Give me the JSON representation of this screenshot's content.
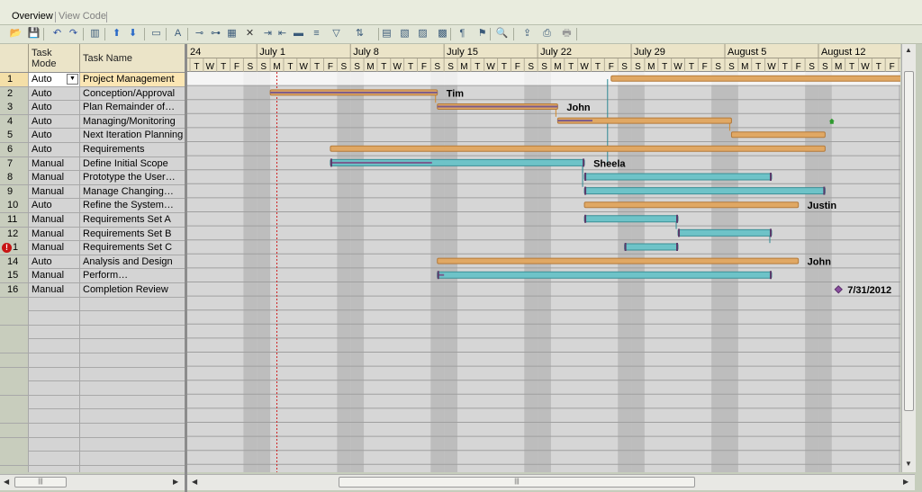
{
  "tabs": [
    {
      "label": "Overview",
      "active": true
    },
    {
      "label": "View Code",
      "active": false
    }
  ],
  "toolbar": {
    "icons": [
      "open-folder-icon",
      "save-icon",
      "undo-icon",
      "redo-icon",
      "columns-icon",
      "move-up-icon",
      "move-down-icon",
      "task-info-icon",
      "fit-text-icon",
      "link-icon",
      "unlink-icon",
      "calendar-icon",
      "delete-icon",
      "indent-icon",
      "outdent-icon",
      "progress-icon",
      "bar-style-icon",
      "filter-icon",
      "sort-icon",
      "table-icon",
      "layout-icon",
      "chart-icon",
      "report-icon",
      "format-icon",
      "critical-path-icon",
      "zoom-icon",
      "export-icon",
      "print-preview-icon",
      "print-icon"
    ]
  },
  "grid": {
    "headers": {
      "id": "",
      "mode": "Task\nMode",
      "name": "Task Name"
    },
    "rows": [
      {
        "id": "1",
        "mode": "Auto",
        "name": "Project Management",
        "selected": true,
        "warning": false
      },
      {
        "id": "2",
        "mode": "Auto",
        "name": "Conception/Approval"
      },
      {
        "id": "3",
        "mode": "Auto",
        "name": "Plan  Remainder of…"
      },
      {
        "id": "4",
        "mode": "Auto",
        "name": "Managing/Monitoring"
      },
      {
        "id": "5",
        "mode": "Auto",
        "name": "Next Iteration Planning"
      },
      {
        "id": "6",
        "mode": "Auto",
        "name": "Requirements"
      },
      {
        "id": "7",
        "mode": "Manual",
        "name": "Define Initial Scope"
      },
      {
        "id": "8",
        "mode": "Manual",
        "name": "Prototype the User…"
      },
      {
        "id": "9",
        "mode": "Manual",
        "name": "Manage  Changing…"
      },
      {
        "id": "10",
        "mode": "Auto",
        "name": "Refine the System…"
      },
      {
        "id": "11",
        "mode": "Manual",
        "name": "Requirements Set A"
      },
      {
        "id": "12",
        "mode": "Manual",
        "name": "Requirements Set B"
      },
      {
        "id": "1",
        "mode": "Manual",
        "name": "Requirements Set C",
        "warning": true
      },
      {
        "id": "14",
        "mode": "Auto",
        "name": "Analysis and Design"
      },
      {
        "id": "15",
        "mode": "Manual",
        "name": "Perform…"
      },
      {
        "id": "16",
        "mode": "Manual",
        "name": "Completion Review"
      }
    ],
    "empty_rows": 13
  },
  "timescale": {
    "weeks": [
      "24",
      "July 1",
      "July 8",
      "July 15",
      "July 22",
      "July 29",
      "August 5",
      "August 12"
    ],
    "day_letters": [
      "T",
      "W",
      "T",
      "F",
      "S",
      "S",
      "M",
      "T",
      "W",
      "T",
      "F",
      "S",
      "S",
      "M",
      "T",
      "W",
      "T",
      "F",
      "S",
      "S",
      "M",
      "T",
      "W",
      "T",
      "F",
      "S",
      "S",
      "M",
      "T",
      "W",
      "T",
      "F",
      "S",
      "S",
      "M",
      "T",
      "W",
      "T",
      "F",
      "S",
      "S",
      "M",
      "T",
      "W",
      "T",
      "F",
      "S",
      "S",
      "M",
      "T",
      "W",
      "T",
      "F",
      "S",
      "S",
      "M",
      "T",
      "W",
      "T",
      "F",
      "S",
      "S",
      "M",
      "T",
      "W",
      "T",
      "F",
      "S",
      "S",
      "M",
      "T",
      "W",
      "T",
      "F"
    ],
    "first_day_weekday": "T",
    "weekend_shade": "#bdbdbd",
    "today_line_day": 6.5
  },
  "tasks": [
    {
      "row": 0,
      "type": "summary",
      "start": 31.5,
      "end": 76,
      "label": ""
    },
    {
      "row": 1,
      "type": "summary",
      "start": 6,
      "end": 18.5,
      "label": "Tim",
      "progress": 1
    },
    {
      "row": 2,
      "type": "summary",
      "start": 18.5,
      "end": 27.5,
      "label": "John",
      "progress": 1
    },
    {
      "row": 3,
      "type": "summary",
      "start": 27.5,
      "end": 40.5,
      "label": "",
      "progress": 0.2
    },
    {
      "row": 4,
      "type": "summary",
      "start": 40.5,
      "end": 47.5,
      "label": ""
    },
    {
      "row": 5,
      "type": "summary",
      "start": 10.5,
      "end": 47.5,
      "label": ""
    },
    {
      "row": 6,
      "type": "manual",
      "start": 10.5,
      "end": 29.5,
      "label": "Sheela",
      "progress": 0.4
    },
    {
      "row": 7,
      "type": "manual",
      "start": 29.5,
      "end": 43.5,
      "label": "",
      "progress": 0
    },
    {
      "row": 8,
      "type": "manual",
      "start": 29.5,
      "end": 47.5,
      "label": "",
      "progress": 0
    },
    {
      "row": 9,
      "type": "summary",
      "start": 29.5,
      "end": 45.5,
      "label": "Justin"
    },
    {
      "row": 10,
      "type": "manual",
      "start": 29.5,
      "end": 36.5,
      "label": "",
      "progress": 0
    },
    {
      "row": 11,
      "type": "manual",
      "start": 36.5,
      "end": 43.5,
      "label": "",
      "progress": 0
    },
    {
      "row": 12,
      "type": "manual",
      "start": 32.5,
      "end": 36.5,
      "label": "",
      "progress": 0
    },
    {
      "row": 13,
      "type": "summary",
      "start": 18.5,
      "end": 45.5,
      "label": "John"
    },
    {
      "row": 14,
      "type": "manual",
      "start": 18.5,
      "end": 43.5,
      "label": "",
      "progress": 0.02
    },
    {
      "row": 15,
      "type": "milestone",
      "start": 48.5,
      "label": "7/31/2012"
    }
  ],
  "colors": {
    "summary_bar": "#e0a864",
    "summary_border": "#b47a3a",
    "manual_bar": "#6ec3c8",
    "manual_border": "#3a8f95",
    "progress": "#7a5a8c",
    "link": "#d08a30",
    "link_manual": "#2e8a94",
    "milestone": "#8a4f9e",
    "selection_bg": "#ffffff"
  }
}
